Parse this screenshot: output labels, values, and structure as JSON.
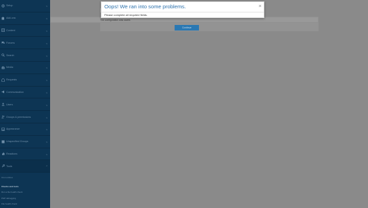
{
  "sidebar": {
    "items": [
      {
        "label": "Setup",
        "icon": "gear-icon"
      },
      {
        "label": "Add-ons",
        "icon": "puzzle-icon"
      },
      {
        "label": "Content",
        "icon": "content-icon"
      },
      {
        "label": "Forums",
        "icon": "forums-icon"
      },
      {
        "label": "Search",
        "icon": "search-icon"
      },
      {
        "label": "Media",
        "icon": "camera-icon"
      },
      {
        "label": "Requests",
        "icon": "inbox-icon"
      },
      {
        "label": "Communication",
        "icon": "megaphone-icon"
      },
      {
        "label": "Users",
        "icon": "user-icon"
      },
      {
        "label": "Groups & permissions",
        "icon": "group-icon"
      },
      {
        "label": "Appearance",
        "icon": "image-icon"
      },
      {
        "label": "Unspecified Groups",
        "icon": "unspecified-groups-icon"
      },
      {
        "label": "Reactions",
        "icon": "reaction-icon"
      },
      {
        "label": "Tools",
        "icon": "wrench-icon"
      }
    ],
    "tools_sub": {
      "first": "Cron entries",
      "heading": "Checks and tools",
      "items": [
        "Run a file health check",
        "PHP debugging",
        "File health check"
      ]
    }
  },
  "background": {
    "message": "The configuration was saved.",
    "button_label": "Continue"
  },
  "modal": {
    "title": "Oops! We ran into some problems.",
    "close": "×",
    "body": "Please complete all required fields."
  },
  "colors": {
    "sidebar_bg": "#0d3554",
    "accent": "#2f73ad",
    "overlay": "#8a8a8a"
  }
}
